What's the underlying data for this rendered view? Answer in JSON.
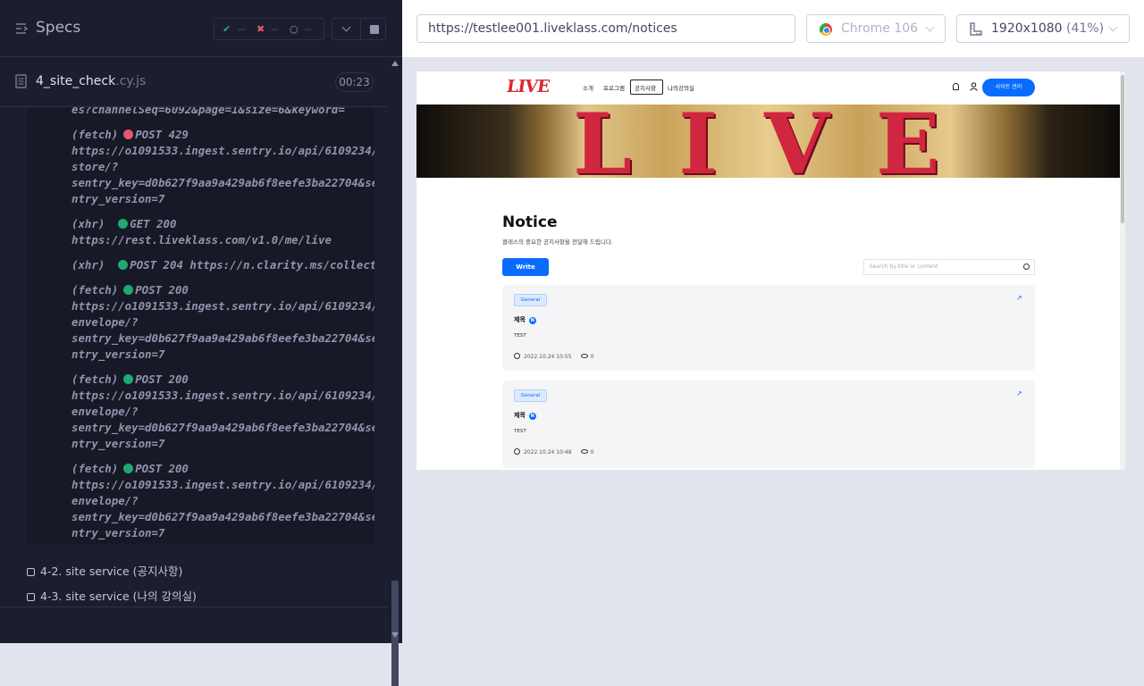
{
  "left": {
    "title": "Specs",
    "stats": {
      "passed": "--",
      "failed": "--",
      "pending": "--"
    },
    "file": {
      "name": "4_site_check",
      "ext": ".cy.js",
      "duration": "00:23"
    },
    "log": [
      {
        "lines": [
          "es?channelSeq=6092&page=1&size=6&keyword="
        ]
      },
      {
        "kind": "(fetch)",
        "status": "red",
        "method": "POST 429",
        "lines": [
          "https://o1091533.ingest.sentry.io/api/6109234/",
          "store/?",
          "sentry_key=d0b627f9aa9a429ab6f8eefe3ba22704&se",
          "ntry_version=7"
        ]
      },
      {
        "kind": "(xhr)",
        "status": "green",
        "method": "GET 200",
        "lines": [
          "https://rest.liveklass.com/v1.0/me/live"
        ]
      },
      {
        "kind": "(xhr)",
        "status": "green",
        "method": "POST 204 https://n.clarity.ms/collect",
        "lines": []
      },
      {
        "kind": "(fetch)",
        "status": "green",
        "method": "POST 200",
        "lines": [
          "https://o1091533.ingest.sentry.io/api/6109234/",
          "envelope/?",
          "sentry_key=d0b627f9aa9a429ab6f8eefe3ba22704&se",
          "ntry_version=7"
        ]
      },
      {
        "kind": "(fetch)",
        "status": "green",
        "method": "POST 200",
        "lines": [
          "https://o1091533.ingest.sentry.io/api/6109234/",
          "envelope/?",
          "sentry_key=d0b627f9aa9a429ab6f8eefe3ba22704&se",
          "ntry_version=7"
        ]
      },
      {
        "kind": "(fetch)",
        "status": "green",
        "method": "POST 200",
        "lines": [
          "https://o1091533.ingest.sentry.io/api/6109234/",
          "envelope/?",
          "sentry_key=d0b627f9aa9a429ab6f8eefe3ba22704&se",
          "ntry_version=7"
        ]
      }
    ],
    "children": [
      "4-2. site service (공지사항)",
      "4-3. site service (나의 강의실)"
    ]
  },
  "right": {
    "url": "https://testlee001.liveklass.com/notices",
    "browser": "Chrome 106",
    "viewport": "1920x1080",
    "scale": "(41%)"
  },
  "site": {
    "logo": "LIVE",
    "nav": [
      "소개",
      "프로그램",
      "공지사항",
      "나의강의실"
    ],
    "admin_button": "사이트 관리",
    "banner_text": "LIVE",
    "notice_title": "Notice",
    "notice_subtitle": "클래스의 중요한 공지사항을 전달해 드립니다.",
    "write_button": "Write",
    "search_placeholder": "Search by title or content",
    "cards": [
      {
        "tag": "General",
        "title": "제목",
        "badge": "N",
        "body": "TEST",
        "date": "2022.10.24 10:55",
        "views": "0"
      },
      {
        "tag": "General",
        "title": "제목",
        "badge": "N",
        "body": "TEST",
        "date": "2022.10.24 10:48",
        "views": "0"
      }
    ]
  },
  "colors": {
    "accent": "#0a6cff",
    "fail": "#e45770",
    "pass": "#1fa971"
  }
}
